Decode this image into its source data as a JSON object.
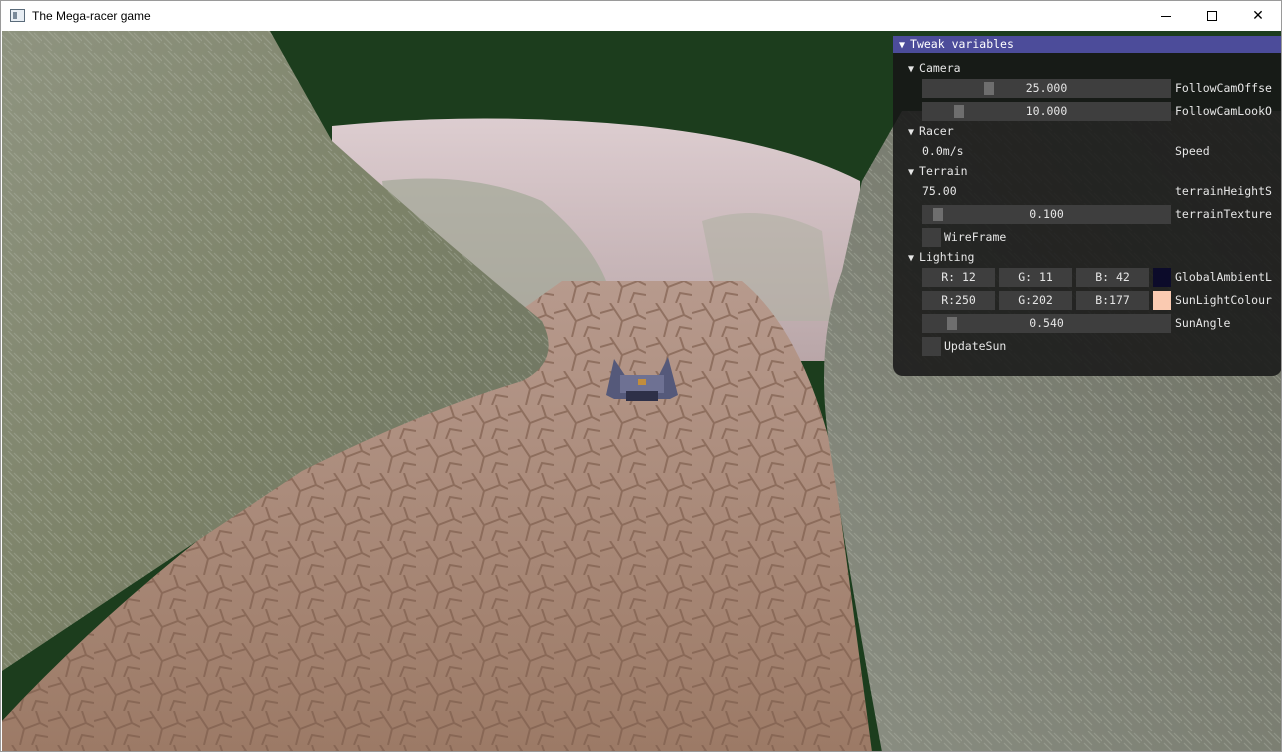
{
  "window": {
    "title": "The Mega-racer game"
  },
  "titlebar": {
    "minimize": "—",
    "maximize": "□",
    "close": "✕"
  },
  "scene": {
    "sky_color": "#1c3d1d",
    "road_color": "#a27f6c",
    "fog_color": "#d6c4c8"
  },
  "tweak": {
    "title": "Tweak variables",
    "camera": {
      "label": "Camera",
      "follow_offset": {
        "value": "25.000",
        "label": "FollowCamOffse",
        "fraction": 0.25
      },
      "follow_look": {
        "value": "10.000",
        "label": "FollowCamLookO",
        "fraction": 0.12
      }
    },
    "racer": {
      "label": "Racer",
      "speed_value": "0.0m/s",
      "speed_label": "Speed"
    },
    "terrain": {
      "label": "Terrain",
      "height_value": "75.00",
      "height_label": "terrainHeightS",
      "texture": {
        "value": "0.100",
        "label": "terrainTexture",
        "fraction": 0.03
      },
      "wireframe_label": "WireFrame"
    },
    "lighting": {
      "label": "Lighting",
      "ambient": {
        "r": "R: 12",
        "g": "G: 11",
        "b": "B: 42",
        "color": "#0c0b2a",
        "label": "GlobalAmbientL"
      },
      "sun": {
        "r": "R:250",
        "g": "G:202",
        "b": "B:177",
        "color": "#facab1",
        "label": "SunLightColour"
      },
      "sun_angle": {
        "value": "0.540",
        "label": "SunAngle",
        "fraction": 0.09
      },
      "update_sun_label": "UpdateSun"
    }
  }
}
